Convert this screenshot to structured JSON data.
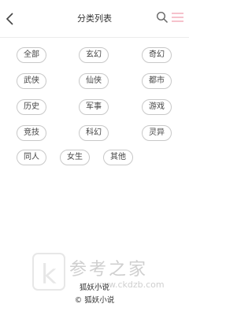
{
  "header": {
    "title": "分类列表",
    "back_icon": "chevron-left-icon",
    "search_icon": "search-icon",
    "menu_icon": "hamburger-menu-icon",
    "accent_color": "#f0a0b0"
  },
  "categories": {
    "row1": [
      "全部",
      "玄幻",
      "奇幻"
    ],
    "row2": [
      "武侠",
      "仙侠",
      "都市"
    ],
    "row3": [
      "历史",
      "军事",
      "游戏"
    ],
    "row4": [
      "竞技",
      "科幻",
      "灵异"
    ],
    "row5": [
      "同人",
      "女生",
      "其他"
    ]
  },
  "footer": {
    "brand": "狐妖小说",
    "copyright": "© 狐妖小说"
  },
  "watermark": {
    "text": "参考之家",
    "url": "www.ckdzb.com"
  }
}
